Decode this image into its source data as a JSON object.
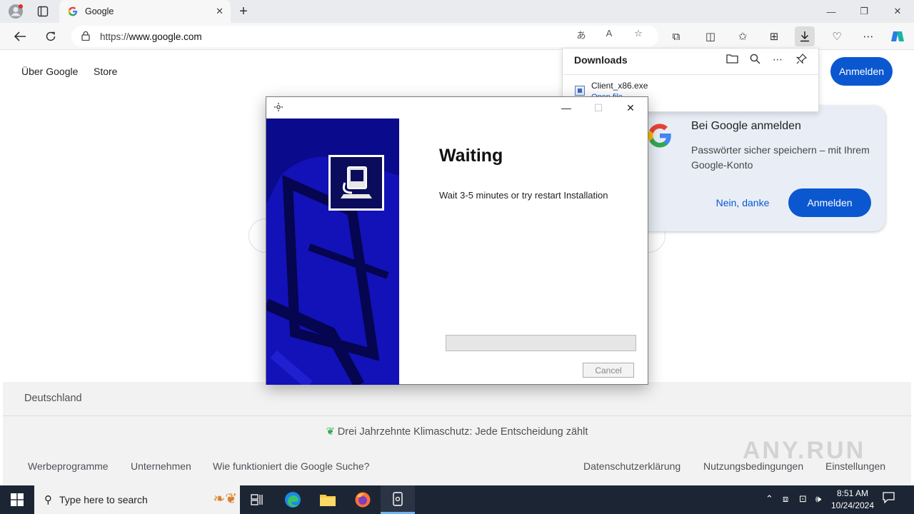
{
  "browser": {
    "tab": {
      "title": "Google"
    },
    "url": {
      "scheme": "https://",
      "host": "www.google.com"
    }
  },
  "google": {
    "top_links": [
      "Über Google",
      "Store"
    ],
    "signin_button": "Anmelden",
    "footer": {
      "country": "Deutschland",
      "climate": "Drei Jahrzehnte Klimaschutz: Jede Entscheidung zählt",
      "left_links": [
        "Werbeprogramme",
        "Unternehmen",
        "Wie funktioniert die Google Suche?"
      ],
      "right_links": [
        "Datenschutzerklärung",
        "Nutzungsbedingungen",
        "Einstellungen"
      ]
    }
  },
  "downloads": {
    "title": "Downloads",
    "file_name": "Client_x86.exe",
    "file_action": "Open file"
  },
  "signin_card": {
    "title": "Bei Google anmelden",
    "text": "Passwörter sicher speichern – mit Ihrem Google-Konto",
    "decline": "Nein, danke",
    "accept": "Anmelden"
  },
  "installer": {
    "heading": "Waiting",
    "message": "Wait 3-5 minutes or try restart Installation",
    "progress": 0,
    "cancel": "Cancel"
  },
  "taskbar": {
    "search_placeholder": "Type here to search",
    "time": "8:51 AM",
    "date": "10/24/2024"
  },
  "watermark": "ANY.RUN",
  "colors": {
    "accent": "#0b57d0",
    "installer_banner": "#0a0a8c",
    "taskbar": "#1c2533"
  }
}
